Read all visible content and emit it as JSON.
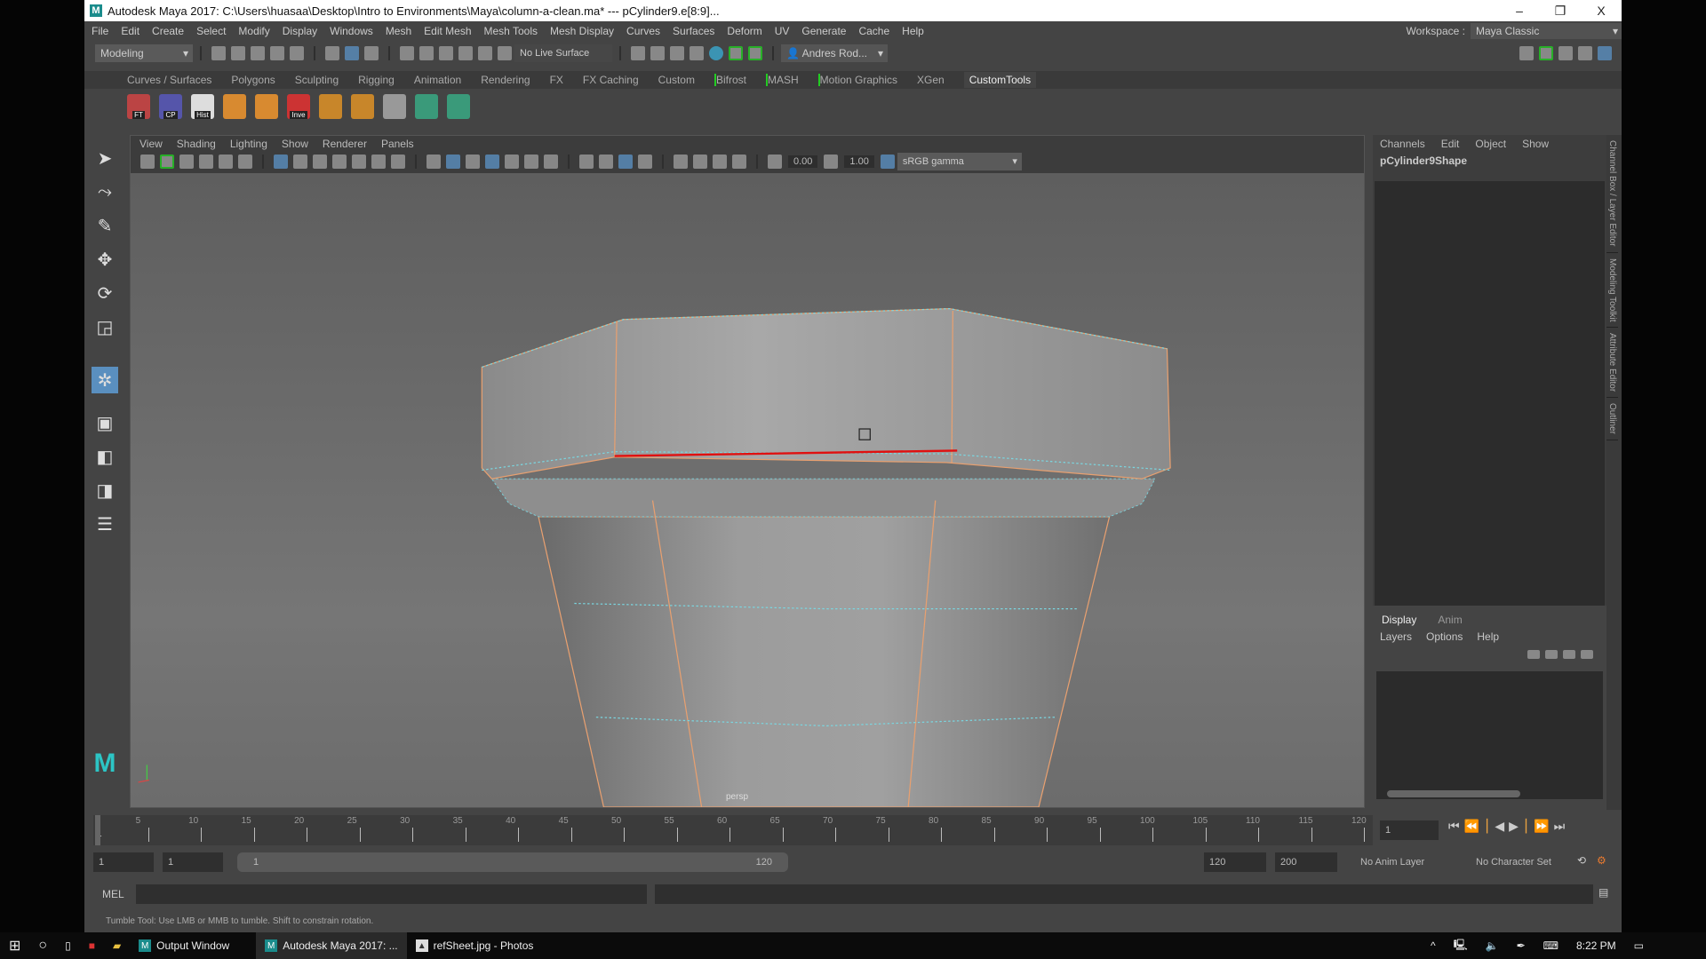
{
  "window": {
    "title": "Autodesk Maya 2017: C:\\Users\\huasaa\\Desktop\\Intro to Environments\\Maya\\column-a-clean.ma*  ---  pCylinder9.e[8:9]...",
    "logo": "M",
    "minimize": "–",
    "restore": "❐",
    "close": "X"
  },
  "menu": [
    "File",
    "Edit",
    "Create",
    "Select",
    "Modify",
    "Display",
    "Windows",
    "Mesh",
    "Edit Mesh",
    "Mesh Tools",
    "Mesh Display",
    "Curves",
    "Surfaces",
    "Deform",
    "UV",
    "Generate",
    "Cache",
    "Help"
  ],
  "workspace": {
    "label": "Workspace :",
    "value": "Maya Classic"
  },
  "status": {
    "mode": "Modeling",
    "live_surface": "No Live Surface",
    "user": "Andres Rod..."
  },
  "shelf": {
    "tabs": [
      "Curves / Surfaces",
      "Polygons",
      "Sculpting",
      "Rigging",
      "Animation",
      "Rendering",
      "FX",
      "FX Caching",
      "Custom",
      "Bifrost",
      "MASH",
      "Motion Graphics",
      "XGen",
      "CustomTools"
    ],
    "active": "CustomTools",
    "buttons": [
      {
        "label": "FT",
        "icon": "freeze-transform-icon"
      },
      {
        "label": "CP",
        "icon": "center-pivot-icon"
      },
      {
        "label": "Hist",
        "icon": "delete-history-icon"
      },
      {
        "label": "",
        "icon": "poly-sphere-icon"
      },
      {
        "label": "",
        "icon": "poly-cube-icon"
      },
      {
        "label": "Inve",
        "icon": "invert-selection-icon"
      },
      {
        "label": "",
        "icon": "extrude-icon"
      },
      {
        "label": "",
        "icon": "bevel-icon"
      },
      {
        "label": "",
        "icon": "pivot-icon"
      },
      {
        "label": "",
        "icon": "uv-cube-icon"
      },
      {
        "label": "",
        "icon": "uv-cylinder-icon"
      }
    ]
  },
  "viewport": {
    "menu": [
      "View",
      "Shading",
      "Lighting",
      "Show",
      "Renderer",
      "Panels"
    ],
    "exposure": "0.00",
    "gamma": "1.00",
    "colorspace": "sRGB gamma",
    "camera": "persp",
    "colors": {
      "edge_selected": "#e01010",
      "wire": "#7ad6e0",
      "border": "#e8a070"
    }
  },
  "channelbox": {
    "menu": [
      "Channels",
      "Edit",
      "Object",
      "Show"
    ],
    "object": "pCylinder9Shape"
  },
  "layereditor": {
    "tabs": [
      "Display",
      "Anim"
    ],
    "menu": [
      "Layers",
      "Options",
      "Help"
    ]
  },
  "sidetabs": [
    "Channel Box / Layer Editor",
    "Modeling Toolkit",
    "Attribute Editor",
    "Outliner"
  ],
  "timeline": {
    "ticks": [
      5,
      10,
      15,
      20,
      25,
      30,
      35,
      40,
      45,
      50,
      55,
      60,
      65,
      70,
      75,
      80,
      85,
      90,
      95,
      100,
      105,
      110,
      115,
      120
    ],
    "current_frame": "1",
    "current_field": "1"
  },
  "range": {
    "start": "1",
    "playback_start": "1",
    "slider_start": "1",
    "slider_end": "120",
    "playback_end": "120",
    "end": "200",
    "anim_layer": "No Anim Layer",
    "char_set": "No Character Set"
  },
  "mel": {
    "label": "MEL"
  },
  "helpline": "Tumble Tool: Use LMB or MMB to tumble. Shift to constrain rotation.",
  "taskbar": {
    "items": [
      "Output Window",
      "Autodesk Maya 2017: ...",
      "refSheet.jpg - Photos"
    ],
    "time": "8:22 PM"
  }
}
